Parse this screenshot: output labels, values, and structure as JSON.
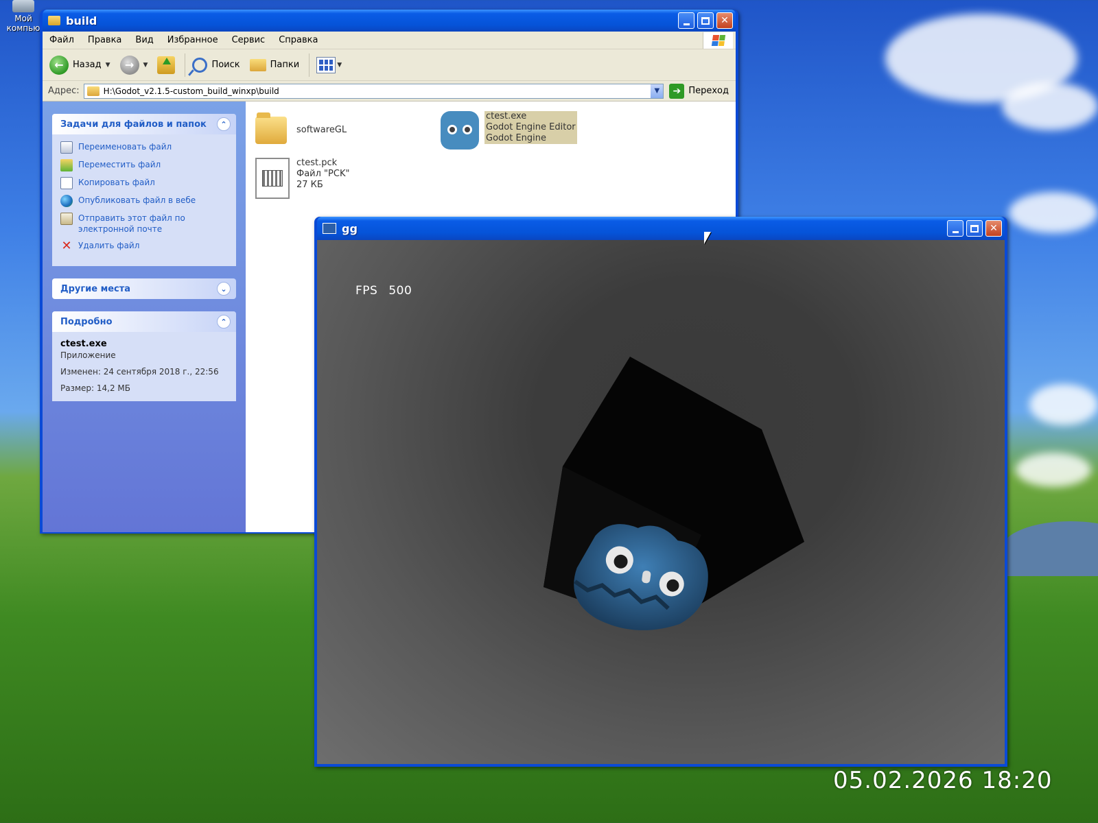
{
  "desktop": {
    "icon_label_line1": "Мой",
    "icon_label_line2": "компью"
  },
  "explorer": {
    "title": "build",
    "menu": [
      "Файл",
      "Правка",
      "Вид",
      "Избранное",
      "Сервис",
      "Справка"
    ],
    "toolbar": {
      "back_label": "Назад",
      "search_label": "Поиск",
      "folders_label": "Папки"
    },
    "address": {
      "label": "Адрес:",
      "value": "H:\\Godot_v2.1.5-custom_build_winxp\\build",
      "go_label": "Переход"
    },
    "tasks_panel": {
      "title": "Задачи для файлов и папок",
      "items": [
        {
          "label": "Переименовать файл",
          "icon": "rename-icon"
        },
        {
          "label": "Переместить файл",
          "icon": "move-icon"
        },
        {
          "label": "Копировать файл",
          "icon": "copy-icon"
        },
        {
          "label": "Опубликовать файл в вебе",
          "icon": "globe-icon"
        },
        {
          "label": "Отправить этот файл по электронной почте",
          "icon": "email-icon"
        },
        {
          "label": "Удалить файл",
          "icon": "delete-icon"
        }
      ]
    },
    "other_places_panel": {
      "title": "Другие места"
    },
    "details_panel": {
      "title": "Подробно",
      "name": "ctest.exe",
      "type": "Приложение",
      "modified": "Изменен: 24 сентября 2018 г., 22:56",
      "size": "Размер: 14,2 МБ"
    },
    "files": [
      {
        "name": "softwareGL",
        "icon": "folder-icon"
      },
      {
        "name": "ctest.exe",
        "line2": "Godot Engine Editor",
        "line3": "Godot Engine",
        "icon": "godot-icon",
        "selected": true
      },
      {
        "name": "ctest.pck",
        "line2": "Файл \"PCK\"",
        "line3": "27 КБ",
        "icon": "pck-file-icon"
      }
    ]
  },
  "game_window": {
    "title": "gg",
    "fps_label": "FPS",
    "fps_value": "500"
  },
  "timestamp": "05.02.2026 18:20",
  "colors": {
    "xp_blue": "#0a4ad6",
    "task_link": "#215dc6",
    "godot_blue": "#478cbf"
  }
}
